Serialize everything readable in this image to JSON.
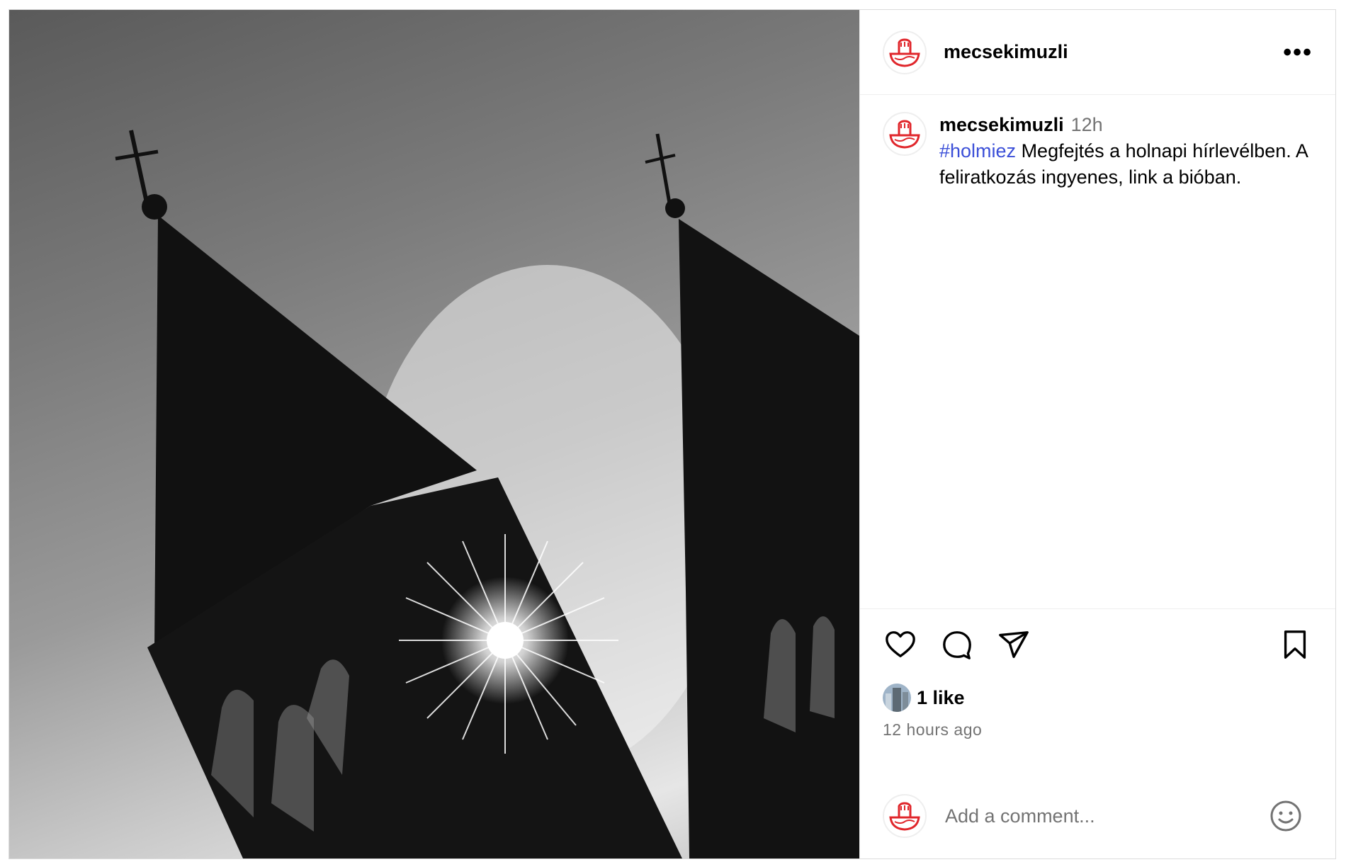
{
  "post": {
    "username": "mecsekimuzli",
    "more_icon": "more-horizontal-icon",
    "caption": {
      "username": "mecsekimuzli",
      "time": "12h",
      "hashtag": "#holmiez",
      "text": " Megfejtés a holnapi hírlevélben. A feliratkozás ingyenes, link a bióban."
    },
    "actions": {
      "like_icon": "heart-icon",
      "comment_icon": "comment-icon",
      "share_icon": "share-icon",
      "save_icon": "bookmark-icon"
    },
    "likes": "1 like",
    "posted_ago": "12 hours ago",
    "comment": {
      "placeholder": "Add a comment...",
      "emoji_icon": "smiley-icon"
    }
  },
  "colors": {
    "brand_red": "#e0262b",
    "hashtag": "#3b4fd8",
    "muted": "#737373",
    "border": "#dbdbdb"
  }
}
